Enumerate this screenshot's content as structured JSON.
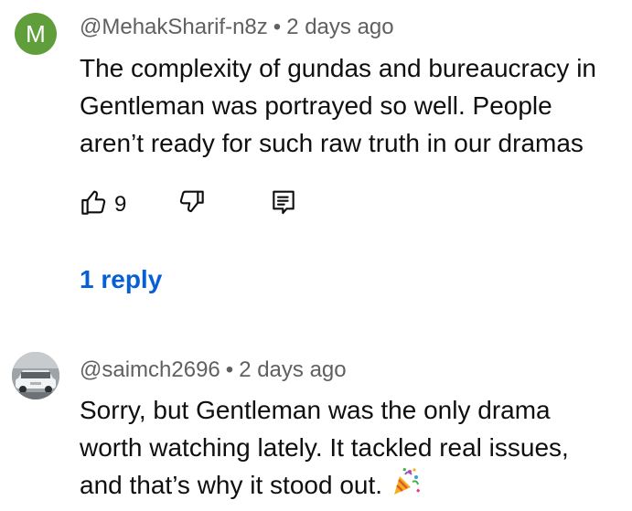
{
  "comments": [
    {
      "avatar_letter": "M",
      "avatar_color": "#5f9e3b",
      "author": "@MehakSharif-n8z",
      "separator": "•",
      "time": "2 days ago",
      "lines": [
        "The complexity of gundas and bureaucracy in",
        "Gentleman was portrayed so well. People",
        "aren’t ready for such raw truth in our dramas"
      ],
      "like_count": "9",
      "replies_label": "1 reply"
    },
    {
      "avatar_icon": "car-photo-avatar",
      "author": "@saimch2696",
      "separator": "•",
      "time": "2 days ago",
      "lines": [
        "Sorry, but Gentleman was the only drama",
        "worth watching lately. It tackled real issues,",
        "and that’s why it stood out."
      ],
      "emoji": "party-popper-icon"
    }
  ],
  "icons": {
    "like": "thumbs-up-icon",
    "dislike": "thumbs-down-icon",
    "reply": "reply-comment-icon"
  },
  "colors": {
    "link": "#065fd4",
    "meta": "#606060",
    "text": "#0f0f0f"
  }
}
